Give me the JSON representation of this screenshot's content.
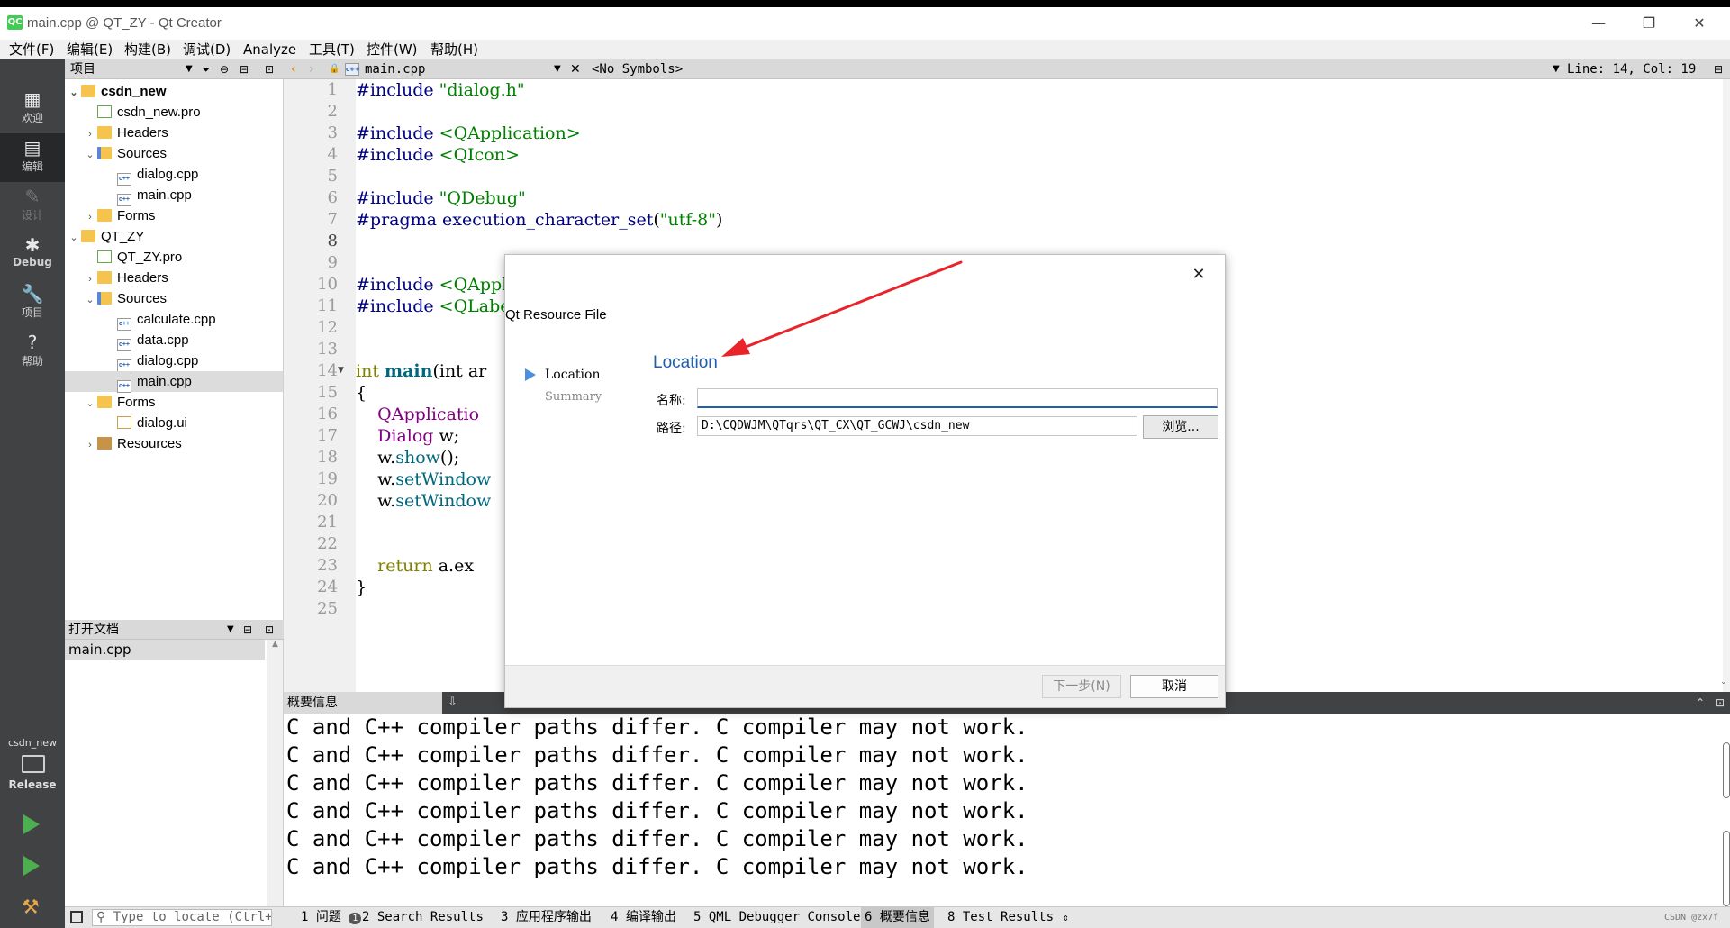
{
  "window": {
    "title": "main.cpp @ QT_ZY - Qt Creator",
    "logo_text": "QC",
    "minimize": "—",
    "restore": "❐",
    "close": "✕"
  },
  "menu": [
    "文件(F)",
    "编辑(E)",
    "构建(B)",
    "调试(D)",
    "Analyze",
    "工具(T)",
    "控件(W)",
    "帮助(H)"
  ],
  "modes": {
    "welcome": "欢迎",
    "edit": "编辑",
    "design": "设计",
    "debug": "Debug",
    "projects": "项目",
    "help": "帮助",
    "kit_project": "csdn_new",
    "kit_build": "Release"
  },
  "project_panel": {
    "title": "项目",
    "tree": [
      {
        "label": "csdn_new"
      },
      {
        "label": "csdn_new.pro"
      },
      {
        "label": "Headers"
      },
      {
        "label": "Sources"
      },
      {
        "label": "dialog.cpp"
      },
      {
        "label": "main.cpp"
      },
      {
        "label": "Forms"
      },
      {
        "label": "QT_ZY"
      },
      {
        "label": "QT_ZY.pro"
      },
      {
        "label": "Headers"
      },
      {
        "label": "Sources"
      },
      {
        "label": "calculate.cpp"
      },
      {
        "label": "data.cpp"
      },
      {
        "label": "dialog.cpp"
      },
      {
        "label": "main.cpp"
      },
      {
        "label": "Forms"
      },
      {
        "label": "dialog.ui"
      },
      {
        "label": "Resources"
      }
    ],
    "cpp_icon_text": "c++"
  },
  "open_docs": {
    "title": "打开文档",
    "items": [
      "main.cpp"
    ]
  },
  "editor": {
    "file_tab": "main.cpp",
    "symbols": "<No Symbols>",
    "position": "Line: 14, Col: 19",
    "line_numbers": [
      "1",
      "2",
      "3",
      "4",
      "5",
      "6",
      "7",
      "8",
      "9",
      "10",
      "11",
      "12",
      "13",
      "14",
      "15",
      "16",
      "17",
      "18",
      "19",
      "20",
      "21",
      "22",
      "23",
      "24",
      "25"
    ],
    "code": {
      "l1_dir": "#include",
      "l1_str": " \"dialog.h\"",
      "l3_dir": "#include",
      "l3_str": " <QApplication>",
      "l4_dir": "#include",
      "l4_str": " <QIcon>",
      "l6_dir": "#include",
      "l6_str": " \"QDebug\"",
      "l7_dir": "#pragma execution_character_set",
      "l7_rest": "(",
      "l7_str": "\"utf-8\"",
      "l7_end": ")",
      "l10_dir": "#include",
      "l10_str": " <QAppl",
      "l11_dir": "#include",
      "l11_str": " <QLabe",
      "l14_kw": "int",
      "l14_fn": "main",
      "l14_rest": "(int ar",
      "l15": "{",
      "l16": "    QApplicatio",
      "l17_typ": "    Dialog",
      "l17_rest": " w;",
      "l18_pre": "    w.",
      "l18_fn": "show",
      "l18_rest": "();",
      "l19_pre": "    w.",
      "l19_fn": "setWindow",
      "l20_pre": "    w.",
      "l20_fn": "setWindow",
      "l23_kw": "    return",
      "l23_rest": " a.ex",
      "l24": "}"
    }
  },
  "output": {
    "title": "概要信息",
    "lines": [
      "C and C++ compiler paths differ. C compiler may not work.",
      "C and C++ compiler paths differ. C compiler may not work.",
      "C and C++ compiler paths differ. C compiler may not work.",
      "C and C++ compiler paths differ. C compiler may not work.",
      "C and C++ compiler paths differ. C compiler may not work.",
      "C and C++ compiler paths differ. C compiler may not work."
    ]
  },
  "statusbar": {
    "locate_placeholder": "Type to locate (Ctrl+...",
    "tabs": [
      {
        "num": "1",
        "label": "问题",
        "badge": "1"
      },
      {
        "num": "2",
        "label": "Search Results"
      },
      {
        "num": "3",
        "label": "应用程序输出"
      },
      {
        "num": "4",
        "label": "编译输出"
      },
      {
        "num": "5",
        "label": "QML Debugger Console"
      },
      {
        "num": "6",
        "label": "概要信息"
      },
      {
        "num": "8",
        "label": "Test Results"
      }
    ],
    "watermark": "CSDN @zx7f"
  },
  "dialog": {
    "title": "Qt Resource File",
    "close": "✕",
    "steps": [
      "Location",
      "Summary"
    ],
    "section_title": "Location",
    "name_label": "名称:",
    "name_value": "",
    "path_label": "路径:",
    "path_value": "D:\\CQDWJM\\QTqrs\\QT_CX\\QT_GCWJ\\csdn_new",
    "browse": "浏览...",
    "next": "下一步(N)",
    "cancel": "取消"
  },
  "colors": {
    "accent": "#1f5fae",
    "arrow": "#e8232a"
  }
}
